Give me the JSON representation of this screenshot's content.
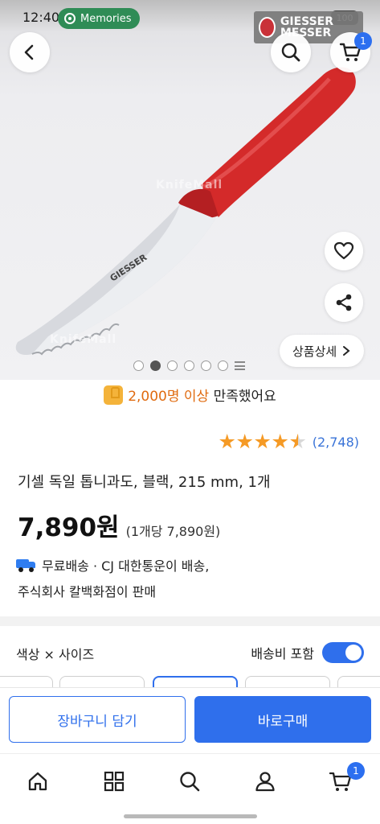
{
  "status_bar": {
    "time": "12:40",
    "memories_label": "Memories",
    "battery": "100"
  },
  "hero": {
    "brand_logo_text": "GIESSER MESSER",
    "watermark_top": "KnifeMall",
    "watermark_bottom": "KnifeMall",
    "cart_badge": "1",
    "detail_button": "상품상세",
    "carousel": {
      "total": 6,
      "active_index": 1
    }
  },
  "product": {
    "sold_text_highlight": "2,000명 이상",
    "sold_text_rest": " 만족했어요",
    "rating": 4.5,
    "rating_count": "(2,748)",
    "title": "기셀 독일 톱니과도, 블랙, 215 mm, 1개",
    "price": "7,890원",
    "unit_price": "(1개당 7,890원)",
    "shipping_line": "무료배송 · CJ 대한통운이 배송,",
    "seller_line": "주식회사 칼백화점이 판매"
  },
  "options": {
    "label": "색상 × 사이즈",
    "shipping_toggle_label": "배송비 포함",
    "shipping_toggle_on": true
  },
  "cta": {
    "cart_button": "장바구니 담기",
    "buy_button": "바로구매"
  },
  "bottom_nav": {
    "cart_badge": "1",
    "items": [
      "home-icon",
      "category-icon",
      "search-icon",
      "profile-icon",
      "cart-icon"
    ]
  },
  "colors": {
    "accent": "#2f6fec",
    "rating_star": "#f59a25",
    "sold_highlight": "#e06b10",
    "knife_handle": "#d42a2a"
  }
}
